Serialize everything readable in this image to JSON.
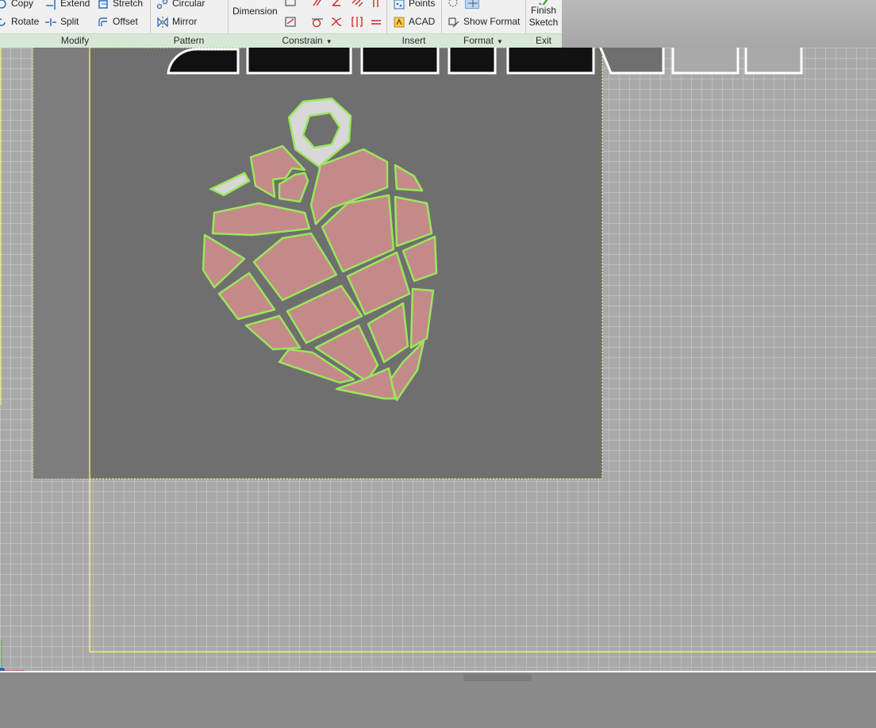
{
  "ribbon": {
    "modify": {
      "label": "Modify",
      "copy": "Copy",
      "rotate": "Rotate",
      "extend": "Extend",
      "split": "Split",
      "stretch": "Stretch",
      "offset": "Offset"
    },
    "pattern": {
      "label": "Pattern",
      "circular": "Circular",
      "mirror": "Mirror"
    },
    "constrain": {
      "label": "Constrain",
      "dimension": "Dimension"
    },
    "insert": {
      "label": "Insert",
      "points": "Points",
      "acad": "ACAD"
    },
    "format": {
      "label": "Format",
      "show_format": "Show Format"
    },
    "exit": {
      "label": "Exit",
      "finish_line1": "Finish",
      "finish_line2": "Sketch"
    }
  },
  "colors": {
    "ribbon_bg": "#f0f0f0",
    "panel_label_bg": "#d7e8d6",
    "canvas_bg": "#a9a9a9",
    "plate": "#6f6f6f",
    "region_fill": "#c48a8a",
    "profile_outline": "#9be65c",
    "sketch_boundary": "#ffff66",
    "text_outline_fill": "#111111"
  },
  "icons": {
    "copy": "copy-icon",
    "rotate": "rotate-icon",
    "extend": "extend-icon",
    "split": "split-icon",
    "stretch": "stretch-icon",
    "offset": "offset-icon",
    "circular": "circular-pattern-icon",
    "mirror": "mirror-icon",
    "points": "points-icon",
    "acad": "acad-icon",
    "show_format": "show-format-icon",
    "finish": "finish-sketch-icon"
  }
}
